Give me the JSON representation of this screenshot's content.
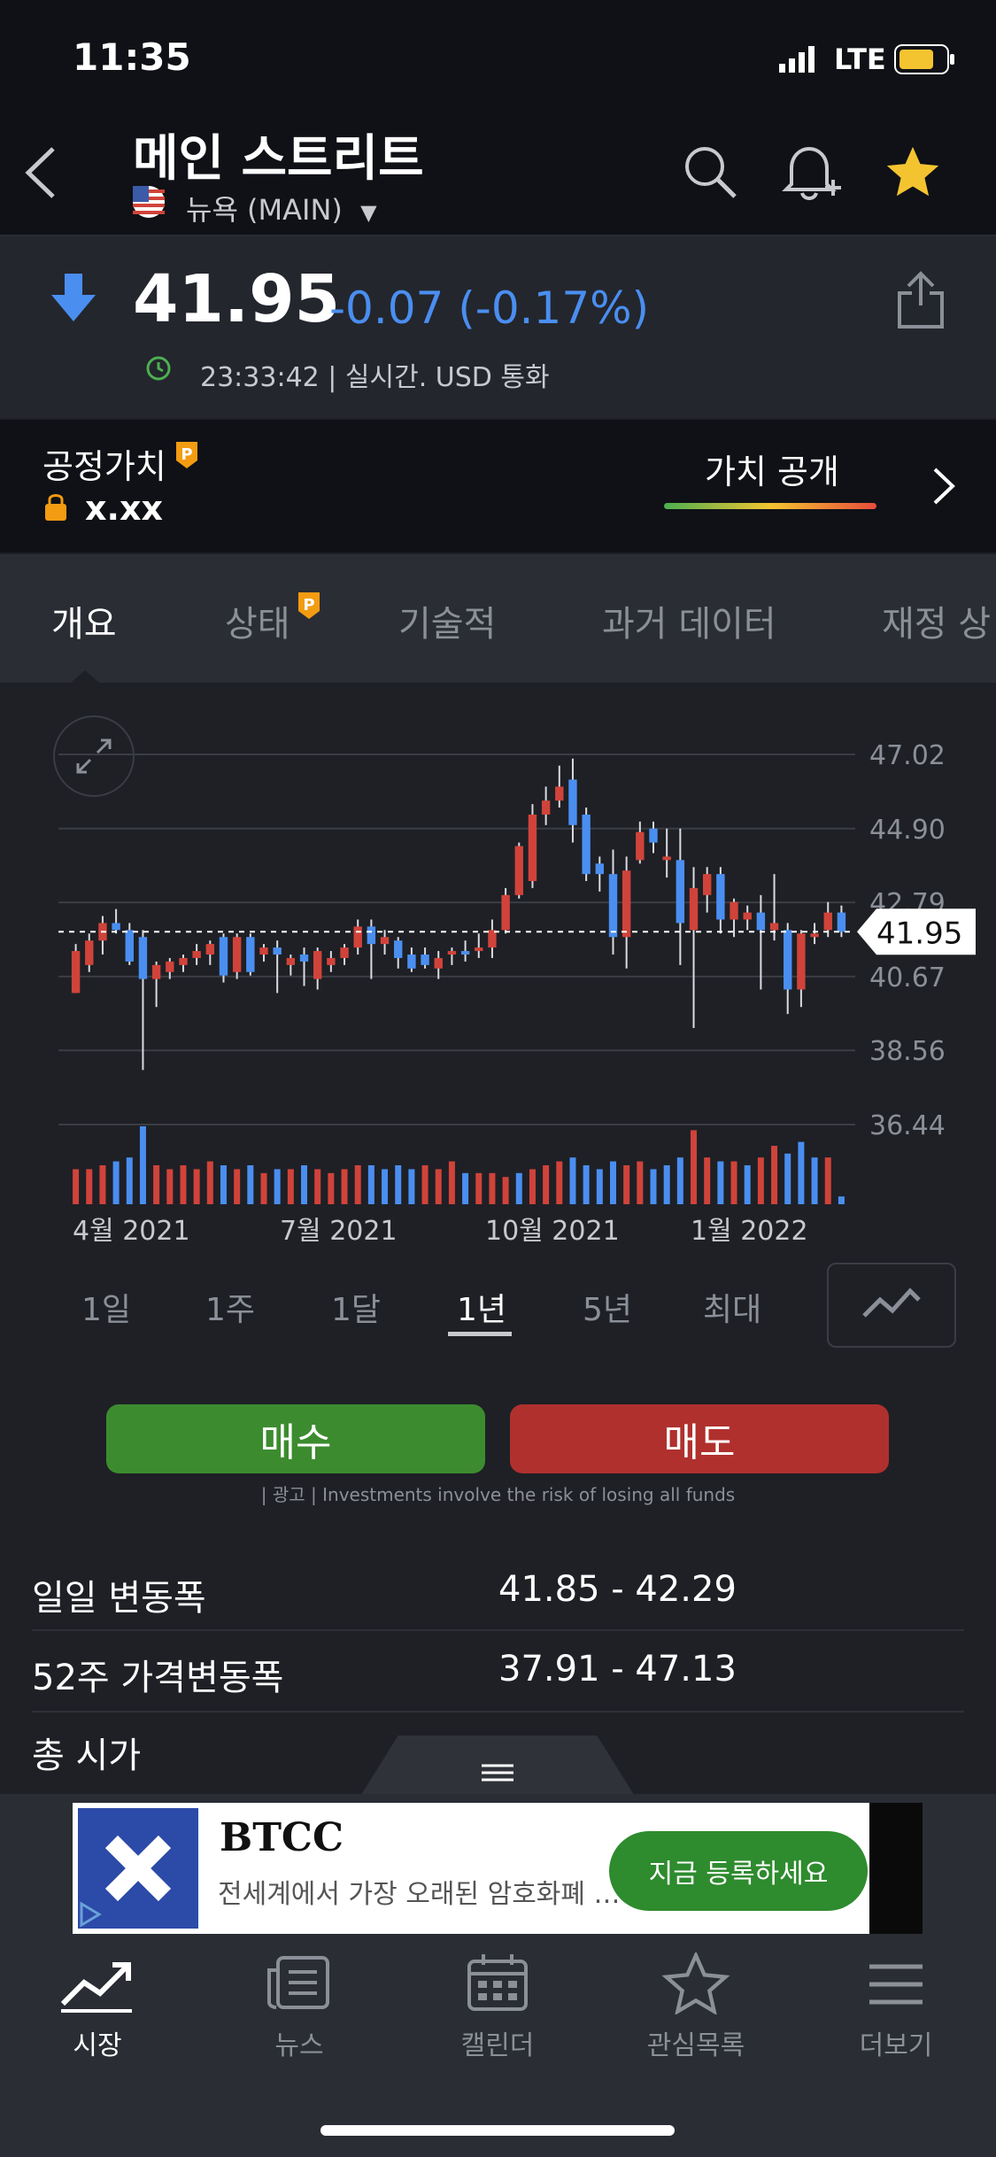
{
  "status_bar": {
    "time": "11:35",
    "network": "LTE"
  },
  "header": {
    "title": "메인 스트리트",
    "exchange": "뉴욕 (MAIN)"
  },
  "quote": {
    "price": "41.95",
    "change": "-0.07 (-0.17%)",
    "timestamp": "23:33:42 | 실시간. USD 통화",
    "change_color": "#4a8ef0"
  },
  "fair_value": {
    "label": "공정가치",
    "value": "x.xx",
    "reveal": "가치 공개"
  },
  "tabs": [
    "개요",
    "상태",
    "기술적",
    "과거 데이터",
    "재정 상"
  ],
  "chart_data": {
    "type": "candlestick",
    "y_ticks": [
      "47.02",
      "44.90",
      "42.79",
      "40.67",
      "38.56",
      "36.44"
    ],
    "ylim": [
      36.44,
      47.02
    ],
    "x_labels": [
      "4월 2021",
      "7월 2021",
      "10월 2021",
      "1월 2022"
    ],
    "current_price_label": "41.95",
    "current_price": 41.95,
    "up_color": "#d0433a",
    "down_color": "#4a8ef0",
    "candles": [
      {
        "o": 40.2,
        "h": 41.6,
        "l": 40.2,
        "c": 41.4
      },
      {
        "o": 41.0,
        "h": 41.9,
        "l": 40.8,
        "c": 41.7
      },
      {
        "o": 41.7,
        "h": 42.4,
        "l": 41.3,
        "c": 42.2
      },
      {
        "o": 42.2,
        "h": 42.6,
        "l": 41.9,
        "c": 42.0
      },
      {
        "o": 42.0,
        "h": 42.2,
        "l": 41.0,
        "c": 41.1
      },
      {
        "o": 41.8,
        "h": 42.0,
        "l": 38.0,
        "c": 40.6
      },
      {
        "o": 40.6,
        "h": 41.1,
        "l": 39.8,
        "c": 41.0
      },
      {
        "o": 40.8,
        "h": 41.2,
        "l": 40.6,
        "c": 41.1
      },
      {
        "o": 41.0,
        "h": 41.3,
        "l": 40.8,
        "c": 41.2
      },
      {
        "o": 41.2,
        "h": 41.6,
        "l": 41.0,
        "c": 41.4
      },
      {
        "o": 41.3,
        "h": 41.7,
        "l": 41.0,
        "c": 41.6
      },
      {
        "o": 41.8,
        "h": 41.9,
        "l": 40.5,
        "c": 40.7
      },
      {
        "o": 40.8,
        "h": 41.9,
        "l": 40.6,
        "c": 41.8
      },
      {
        "o": 41.8,
        "h": 41.9,
        "l": 40.7,
        "c": 40.8
      },
      {
        "o": 41.3,
        "h": 41.6,
        "l": 41.1,
        "c": 41.5
      },
      {
        "o": 41.5,
        "h": 41.7,
        "l": 40.2,
        "c": 41.3
      },
      {
        "o": 41.0,
        "h": 41.3,
        "l": 40.7,
        "c": 41.2
      },
      {
        "o": 41.3,
        "h": 41.5,
        "l": 40.4,
        "c": 41.1
      },
      {
        "o": 40.6,
        "h": 41.5,
        "l": 40.3,
        "c": 41.4
      },
      {
        "o": 41.0,
        "h": 41.4,
        "l": 40.8,
        "c": 41.2
      },
      {
        "o": 41.2,
        "h": 41.6,
        "l": 41.0,
        "c": 41.5
      },
      {
        "o": 41.5,
        "h": 42.3,
        "l": 41.3,
        "c": 42.1
      },
      {
        "o": 42.1,
        "h": 42.3,
        "l": 40.6,
        "c": 41.6
      },
      {
        "o": 41.6,
        "h": 42.0,
        "l": 41.3,
        "c": 41.8
      },
      {
        "o": 41.7,
        "h": 41.8,
        "l": 40.9,
        "c": 41.2
      },
      {
        "o": 41.3,
        "h": 41.5,
        "l": 40.8,
        "c": 40.9
      },
      {
        "o": 41.3,
        "h": 41.5,
        "l": 40.9,
        "c": 41.0
      },
      {
        "o": 40.9,
        "h": 41.4,
        "l": 40.6,
        "c": 41.2
      },
      {
        "o": 41.3,
        "h": 41.5,
        "l": 41.0,
        "c": 41.4
      },
      {
        "o": 41.4,
        "h": 41.7,
        "l": 41.1,
        "c": 41.3
      },
      {
        "o": 41.4,
        "h": 41.9,
        "l": 41.2,
        "c": 41.5
      },
      {
        "o": 41.5,
        "h": 42.3,
        "l": 41.2,
        "c": 42.0
      },
      {
        "o": 42.0,
        "h": 43.2,
        "l": 41.9,
        "c": 43.0
      },
      {
        "o": 43.0,
        "h": 44.5,
        "l": 42.9,
        "c": 44.4
      },
      {
        "o": 43.4,
        "h": 45.6,
        "l": 43.2,
        "c": 45.3
      },
      {
        "o": 45.3,
        "h": 46.1,
        "l": 45.0,
        "c": 45.7
      },
      {
        "o": 45.7,
        "h": 46.7,
        "l": 45.5,
        "c": 46.1
      },
      {
        "o": 46.3,
        "h": 46.9,
        "l": 44.5,
        "c": 45.0
      },
      {
        "o": 45.3,
        "h": 45.5,
        "l": 43.4,
        "c": 43.6
      },
      {
        "o": 43.9,
        "h": 44.1,
        "l": 43.1,
        "c": 43.6
      },
      {
        "o": 43.6,
        "h": 44.3,
        "l": 41.3,
        "c": 41.8
      },
      {
        "o": 41.8,
        "h": 44.1,
        "l": 40.9,
        "c": 43.7
      },
      {
        "o": 44.0,
        "h": 45.1,
        "l": 43.9,
        "c": 44.8
      },
      {
        "o": 44.9,
        "h": 45.1,
        "l": 44.2,
        "c": 44.5
      },
      {
        "o": 44.0,
        "h": 44.9,
        "l": 43.5,
        "c": 44.1
      },
      {
        "o": 44.0,
        "h": 44.9,
        "l": 41.0,
        "c": 42.2
      },
      {
        "o": 42.0,
        "h": 43.8,
        "l": 39.2,
        "c": 43.2
      },
      {
        "o": 43.0,
        "h": 43.8,
        "l": 42.5,
        "c": 43.6
      },
      {
        "o": 43.6,
        "h": 43.8,
        "l": 41.9,
        "c": 42.3
      },
      {
        "o": 42.3,
        "h": 42.9,
        "l": 41.8,
        "c": 42.8
      },
      {
        "o": 42.3,
        "h": 42.7,
        "l": 42.0,
        "c": 42.5
      },
      {
        "o": 42.5,
        "h": 43.0,
        "l": 40.3,
        "c": 42.0
      },
      {
        "o": 42.0,
        "h": 43.6,
        "l": 41.7,
        "c": 42.2
      },
      {
        "o": 42.0,
        "h": 42.2,
        "l": 39.6,
        "c": 40.3
      },
      {
        "o": 40.3,
        "h": 42.0,
        "l": 39.8,
        "c": 41.9
      },
      {
        "o": 41.8,
        "h": 42.2,
        "l": 41.6,
        "c": 41.9
      },
      {
        "o": 42.0,
        "h": 42.8,
        "l": 41.8,
        "c": 42.5
      },
      {
        "o": 42.5,
        "h": 42.7,
        "l": 41.8,
        "c": 41.95
      }
    ],
    "volumes": [
      {
        "v": 0.45,
        "up": true
      },
      {
        "v": 0.45,
        "up": true
      },
      {
        "v": 0.5,
        "up": true
      },
      {
        "v": 0.55,
        "up": false
      },
      {
        "v": 0.6,
        "up": false
      },
      {
        "v": 1.0,
        "up": false
      },
      {
        "v": 0.5,
        "up": true
      },
      {
        "v": 0.45,
        "up": true
      },
      {
        "v": 0.5,
        "up": true
      },
      {
        "v": 0.45,
        "up": true
      },
      {
        "v": 0.55,
        "up": true
      },
      {
        "v": 0.5,
        "up": false
      },
      {
        "v": 0.45,
        "up": true
      },
      {
        "v": 0.5,
        "up": false
      },
      {
        "v": 0.4,
        "up": true
      },
      {
        "v": 0.45,
        "up": false
      },
      {
        "v": 0.45,
        "up": true
      },
      {
        "v": 0.5,
        "up": false
      },
      {
        "v": 0.45,
        "up": true
      },
      {
        "v": 0.4,
        "up": true
      },
      {
        "v": 0.45,
        "up": true
      },
      {
        "v": 0.5,
        "up": true
      },
      {
        "v": 0.5,
        "up": false
      },
      {
        "v": 0.45,
        "up": false
      },
      {
        "v": 0.5,
        "up": false
      },
      {
        "v": 0.45,
        "up": false
      },
      {
        "v": 0.5,
        "up": true
      },
      {
        "v": 0.45,
        "up": true
      },
      {
        "v": 0.55,
        "up": true
      },
      {
        "v": 0.4,
        "up": false
      },
      {
        "v": 0.4,
        "up": true
      },
      {
        "v": 0.4,
        "up": true
      },
      {
        "v": 0.35,
        "up": true
      },
      {
        "v": 0.4,
        "up": false
      },
      {
        "v": 0.45,
        "up": true
      },
      {
        "v": 0.5,
        "up": true
      },
      {
        "v": 0.55,
        "up": true
      },
      {
        "v": 0.6,
        "up": false
      },
      {
        "v": 0.5,
        "up": false
      },
      {
        "v": 0.45,
        "up": false
      },
      {
        "v": 0.55,
        "up": false
      },
      {
        "v": 0.5,
        "up": true
      },
      {
        "v": 0.55,
        "up": true
      },
      {
        "v": 0.45,
        "up": false
      },
      {
        "v": 0.5,
        "up": false
      },
      {
        "v": 0.6,
        "up": false
      },
      {
        "v": 0.95,
        "up": true
      },
      {
        "v": 0.6,
        "up": true
      },
      {
        "v": 0.55,
        "up": false
      },
      {
        "v": 0.55,
        "up": true
      },
      {
        "v": 0.5,
        "up": false
      },
      {
        "v": 0.6,
        "up": true
      },
      {
        "v": 0.75,
        "up": true
      },
      {
        "v": 0.65,
        "up": false
      },
      {
        "v": 0.8,
        "up": false
      },
      {
        "v": 0.6,
        "up": false
      },
      {
        "v": 0.6,
        "up": true
      },
      {
        "v": 0.1,
        "up": false
      }
    ]
  },
  "ranges": [
    "1일",
    "1주",
    "1달",
    "1년",
    "5년",
    "최대"
  ],
  "actions": {
    "buy": "매수",
    "sell": "매도",
    "disclaimer": "| 광고 | Investments involve the risk of losing all funds"
  },
  "stats": [
    {
      "label": "일일 변동폭",
      "value": "41.85 - 42.29"
    },
    {
      "label": "52주 가격변동폭",
      "value": "37.91 - 47.13"
    },
    {
      "label": "총 시가",
      "value": ""
    }
  ],
  "ad": {
    "brand": "BTCC",
    "text": "전세계에서 가장 오래된 암호화폐 …",
    "cta": "지금 등록하세요"
  },
  "bottom_nav": [
    "시장",
    "뉴스",
    "캘린더",
    "관심목록",
    "더보기"
  ]
}
